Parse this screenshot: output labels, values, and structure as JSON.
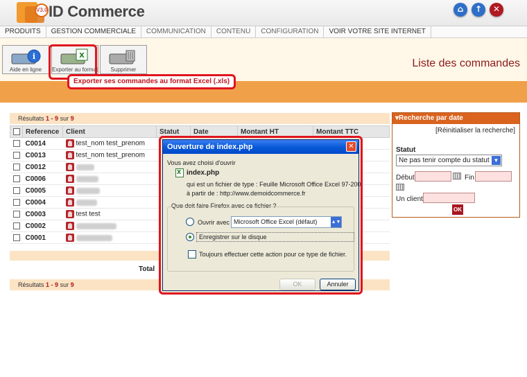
{
  "app": {
    "logo_text": "ID Commerce",
    "version_badge": "V3.0"
  },
  "header_buttons": [
    {
      "icon": "home-icon",
      "glyph": "⌂",
      "color": "#2f6fc8"
    },
    {
      "icon": "up-arrow-icon",
      "glyph": "↑",
      "color": "#2f6fc8"
    },
    {
      "icon": "close-icon",
      "glyph": "✕",
      "color": "#b01a22"
    }
  ],
  "menu": [
    {
      "label": "PRODUITS",
      "dim": false
    },
    {
      "label": "GESTION COMMERCIALE",
      "dim": false
    },
    {
      "label": "COMMUNICATION",
      "dim": true
    },
    {
      "label": "CONTENU",
      "dim": true
    },
    {
      "label": "CONFIGURATION",
      "dim": true
    },
    {
      "label": "VOIR VOTRE SITE INTERNET",
      "dim": false
    }
  ],
  "toolbar": {
    "help_label": "Aide en ligne",
    "export_label": "Exporter au format",
    "delete_label": "Supprimer",
    "export_tooltip": "Exporter ses commandes au format Excel (.xls)"
  },
  "page_title": "Liste des commandes",
  "results": {
    "prefix": "Résultats",
    "range": "1 - 9",
    "of": "sur",
    "total": "9"
  },
  "table": {
    "headers": [
      "Reference",
      "Client",
      "Statut",
      "Date",
      "Montant HT",
      "Montant TTC"
    ],
    "rows": [
      {
        "ref": "C0014",
        "client": "test_nom test_prenom",
        "blur": false
      },
      {
        "ref": "C0013",
        "client": "test_nom test_prenom",
        "blur": false
      },
      {
        "ref": "C0012",
        "client": "",
        "blur": true
      },
      {
        "ref": "C0006",
        "client": "",
        "blur": true
      },
      {
        "ref": "C0005",
        "client": "",
        "blur": true
      },
      {
        "ref": "C0004",
        "client": "",
        "blur": true
      },
      {
        "ref": "C0003",
        "client": "test test",
        "blur": false
      },
      {
        "ref": "C0002",
        "client": "",
        "blur": true
      },
      {
        "ref": "C0001",
        "client": "",
        "blur": true
      }
    ],
    "total_label": "Total"
  },
  "search": {
    "title": "Recherche par date",
    "reset": "[Réinitialiser la recherche]",
    "statut_label": "Statut",
    "statut_value": "Ne pas tenir compte du statut",
    "debut_label": "Début",
    "fin_label": "Fin",
    "client_label": "Un client",
    "ok_label": "OK"
  },
  "dialog": {
    "title": "Ouverture de index.php",
    "intro": "Vous avez choisi d'ouvrir",
    "filename": "index.php",
    "type_line_prefix": "qui est un fichier de type :",
    "type_value": "Feuille Microsoft Office Excel 97-200",
    "from_prefix": "à partir de :",
    "from_value": "http://www.demoidcommerce.fr",
    "question": "Que doit faire Firefox avec ce fichier ?",
    "open_with_label": "Ouvrir avec",
    "open_with_value": "Microsoft Office Excel (défaut)",
    "save_label": "Enregistrer sur le disque",
    "always_label": "Toujours effectuer cette action pour ce type de fichier.",
    "ok_label": "OK",
    "cancel_label": "Annuler"
  }
}
